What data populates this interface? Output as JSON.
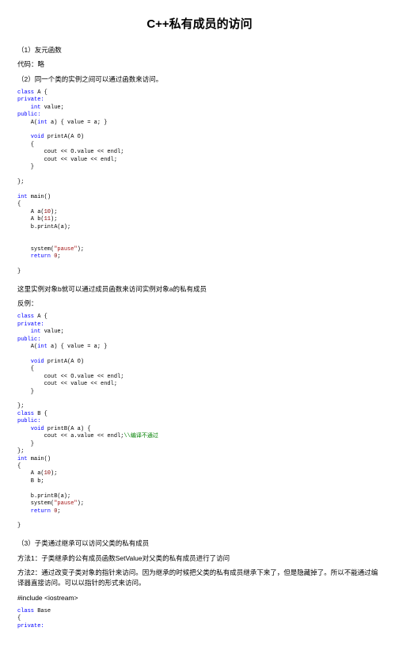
{
  "title": "C++私有成员的访问",
  "p1": "（1）友元函数",
  "p2": "代码：略",
  "p3": "（2）同一个类的实例之间可以通过函数来访问。",
  "code1": {
    "l1a": "class",
    "l1b": " A {",
    "l2": "private:",
    "l3a": "    int",
    "l3b": " value;",
    "l4": "public:",
    "l5a": "    A(",
    "l5b": "int",
    "l5c": " a) { value = a; }",
    "l6a": "    void",
    "l6b": " printA(A O)",
    "l7": "    {",
    "l8": "        cout << O.value << endl;",
    "l9": "        cout << value << endl;",
    "l10": "    }",
    "l11": "};",
    "l12a": "int",
    "l12b": " main()",
    "l13": "{",
    "l14a": "    A a(",
    "l14b": "10",
    "l14c": ");",
    "l15a": "    A b(",
    "l15b": "11",
    "l15c": ");",
    "l16": "    b.printA(a);",
    "l17a": "    system(",
    "l17b": "\"pause\"",
    "l17c": ");",
    "l18a": "    return ",
    "l18b": "0",
    "l18c": ";",
    "l19": "}"
  },
  "p4": "这里实例对象b就可以通过成员函数来访问实例对象a的私有成员",
  "p5": "反例：",
  "code2": {
    "l1a": "class",
    "l1b": " A {",
    "l2": "private:",
    "l3a": "    int",
    "l3b": " value;",
    "l4": "public:",
    "l5a": "    A(",
    "l5b": "int",
    "l5c": " a) { value = a; }",
    "l6a": "    void",
    "l6b": " printA(A O)",
    "l7": "    {",
    "l8": "        cout << O.value << endl;",
    "l9": "        cout << value << endl;",
    "l10": "    }",
    "l11": "};",
    "l12a": "class",
    "l12b": " B {",
    "l13": "public:",
    "l14a": "    void",
    "l14b": " printB(A a) {",
    "l15a": "        cout << a.value << endl;",
    "l15b": "\\\\编译不通过",
    "l16": "    }",
    "l17": "};",
    "l18a": "int",
    "l18b": " main()",
    "l19": "{",
    "l20a": "    A a(",
    "l20b": "10",
    "l20c": ");",
    "l21": "    B b;",
    "l22": "    b.printB(a);",
    "l23a": "    system(",
    "l23b": "\"pause\"",
    "l23c": ");",
    "l24a": "    return ",
    "l24b": "0",
    "l24c": ";",
    "l25": "}"
  },
  "p6": "（3）子类通过继承可以访问父类的私有成员",
  "p7": "方法1：子类继承的公有成员函数SetValue对父类的私有成员进行了访问",
  "p8": "方法2：通过改变子类对象的指针来访问。因为继承的时候把父类的私有成员继承下来了，但是隐藏掉了。所以不能通过编译器直接访问。可以以指针的形式来访问。",
  "p9": "#include <iostream>",
  "code3": {
    "l1a": "class",
    "l1b": " Base",
    "l2": "{",
    "l3": "private:"
  }
}
